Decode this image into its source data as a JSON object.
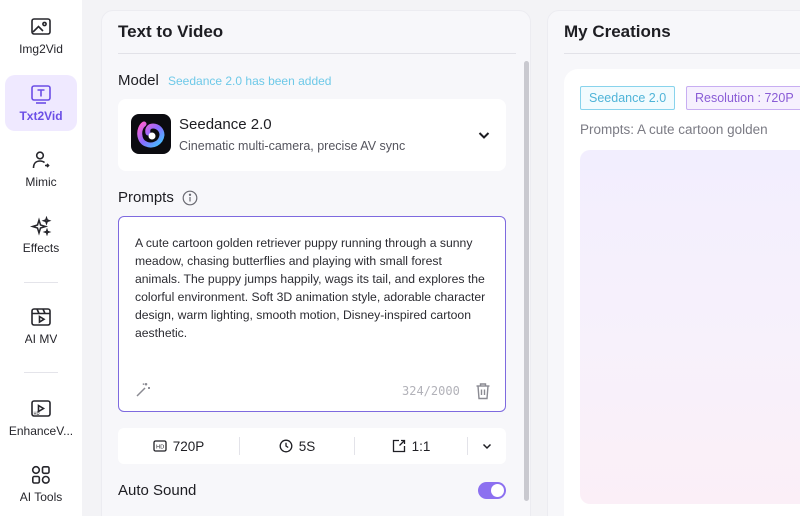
{
  "nav": {
    "items": [
      {
        "label": "Img2Vid",
        "icon": "image-video-icon",
        "active": false
      },
      {
        "label": "Txt2Vid",
        "icon": "text-video-icon",
        "active": true
      },
      {
        "label": "Mimic",
        "icon": "person-motion-icon",
        "active": false
      },
      {
        "label": "Effects",
        "icon": "sparkle-icon",
        "active": false
      },
      {
        "label": "AI MV",
        "icon": "music-video-icon",
        "active": false
      },
      {
        "label": "EnhanceV...",
        "icon": "hd-enhance-icon",
        "active": false
      },
      {
        "label": "AI Tools",
        "icon": "tools-grid-icon",
        "active": false
      }
    ]
  },
  "panel": {
    "title": "Text to Video",
    "model_label": "Model",
    "model_note": "Seedance 2.0 has been added",
    "model": {
      "name": "Seedance 2.0",
      "description": "Cinematic multi-camera, precise AV sync"
    },
    "prompts_label": "Prompts",
    "prompt_text": "A cute cartoon golden retriever puppy running through a sunny meadow, chasing butterflies and playing with small forest animals. The puppy jumps happily, wags its tail, and explores the colorful environment. Soft 3D animation style, adorable character design, warm lighting, smooth motion, Disney-inspired cartoon aesthetic.",
    "char_count": "324/2000",
    "settings": {
      "resolution": "720P",
      "duration": "5S",
      "ratio": "1:1"
    },
    "auto_sound_label": "Auto Sound",
    "auto_sound_on": true
  },
  "creations": {
    "title": "My Creations",
    "card": {
      "model_tag": "Seedance 2.0",
      "resolution_tag": "Resolution : 720P",
      "prompt_preview": "Prompts: A cute cartoon golden"
    }
  },
  "colors": {
    "accent": "#7e6adf",
    "active_nav_bg": "#efe9ff",
    "note": "#6ec9e8"
  }
}
